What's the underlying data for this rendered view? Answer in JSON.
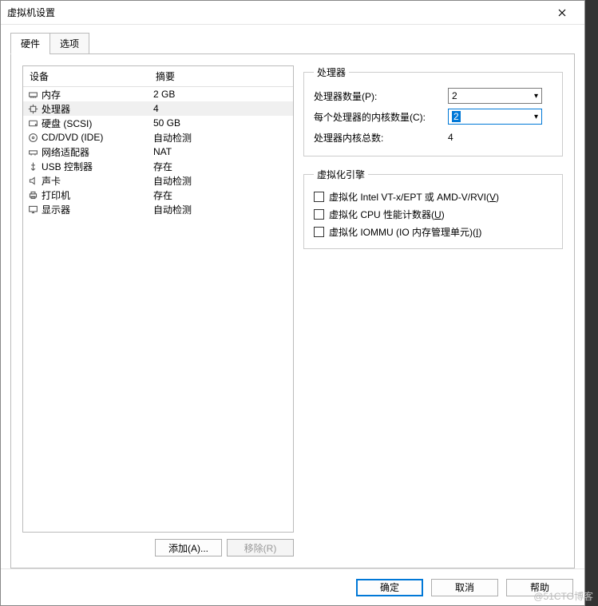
{
  "window": {
    "title": "虚拟机设置"
  },
  "tabs": {
    "hardware": "硬件",
    "options": "选项"
  },
  "device_list": {
    "header_device": "设备",
    "header_summary": "摘要",
    "rows": [
      {
        "name": "内存",
        "summary": "2 GB",
        "icon": "memory"
      },
      {
        "name": "处理器",
        "summary": "4",
        "icon": "cpu",
        "selected": true
      },
      {
        "name": "硬盘 (SCSI)",
        "summary": "50 GB",
        "icon": "hdd"
      },
      {
        "name": "CD/DVD (IDE)",
        "summary": "自动检测",
        "icon": "cd"
      },
      {
        "name": "网络适配器",
        "summary": "NAT",
        "icon": "net"
      },
      {
        "name": "USB 控制器",
        "summary": "存在",
        "icon": "usb"
      },
      {
        "name": "声卡",
        "summary": "自动检测",
        "icon": "sound"
      },
      {
        "name": "打印机",
        "summary": "存在",
        "icon": "printer"
      },
      {
        "name": "显示器",
        "summary": "自动检测",
        "icon": "display"
      }
    ]
  },
  "left_buttons": {
    "add": "添加(A)...",
    "remove": "移除(R)"
  },
  "proc_group": {
    "legend": "处理器",
    "count_label": "处理器数量(P):",
    "count_value": "2",
    "cores_label": "每个处理器的内核数量(C):",
    "cores_value": "2",
    "total_label": "处理器内核总数:",
    "total_value": "4"
  },
  "virt_group": {
    "legend": "虚拟化引擎",
    "opt1_pre": "虚拟化 Intel VT-x/EPT 或 AMD-V/RVI(",
    "opt1_u": "V",
    "opt1_post": ")",
    "opt2_pre": "虚拟化 CPU 性能计数器(",
    "opt2_u": "U",
    "opt2_post": ")",
    "opt3_pre": "虚拟化 IOMMU (IO 内存管理单元)(",
    "opt3_u": "I",
    "opt3_post": ")"
  },
  "footer": {
    "ok": "确定",
    "cancel": "取消",
    "help": "帮助"
  },
  "watermark": "@51CTO博客"
}
